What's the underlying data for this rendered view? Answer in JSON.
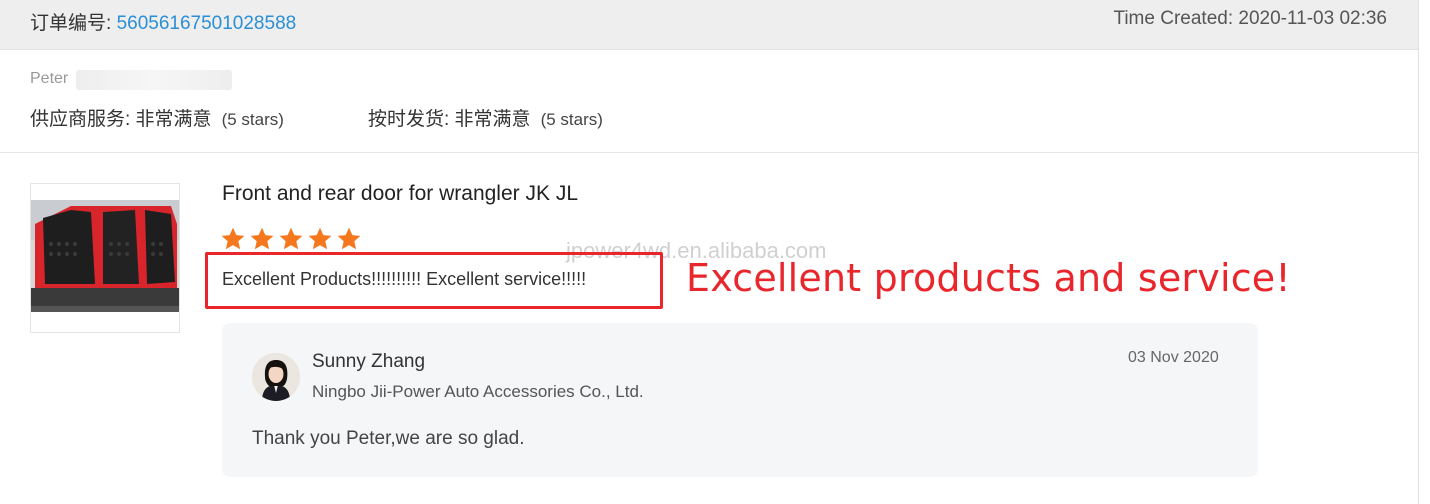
{
  "order": {
    "label": "订单编号: ",
    "number": "56056167501028588",
    "time_created": "Time Created: 2020-11-03 02:36"
  },
  "buyer": {
    "name": "Peter"
  },
  "ratings": {
    "supplier_service_label": "供应商服务: 非常满意",
    "supplier_service_stars": "(5 stars)",
    "on_time_shipping_label": "按时发货: 非常满意",
    "on_time_shipping_stars": "(5 stars)"
  },
  "product": {
    "title": "Front and rear door for wrangler JK JL",
    "rating": 5,
    "star_color": "#f5781f",
    "review_text": "Excellent Products!!!!!!!!!! Excellent service!!!!!"
  },
  "annotation": {
    "text": "Excellent products and service!",
    "color": "#e8262c"
  },
  "watermark": {
    "text": "jpower4wd.en.alibaba.com"
  },
  "reply": {
    "name": "Sunny Zhang",
    "company": "Ningbo Jii-Power Auto Accessories Co., Ltd.",
    "date": "03 Nov 2020",
    "text": "Thank you Peter,we are so glad."
  },
  "colors": {
    "link_blue": "#2a8fd6",
    "header_bg": "#eeeeee",
    "reply_bg": "#f5f6f8"
  }
}
